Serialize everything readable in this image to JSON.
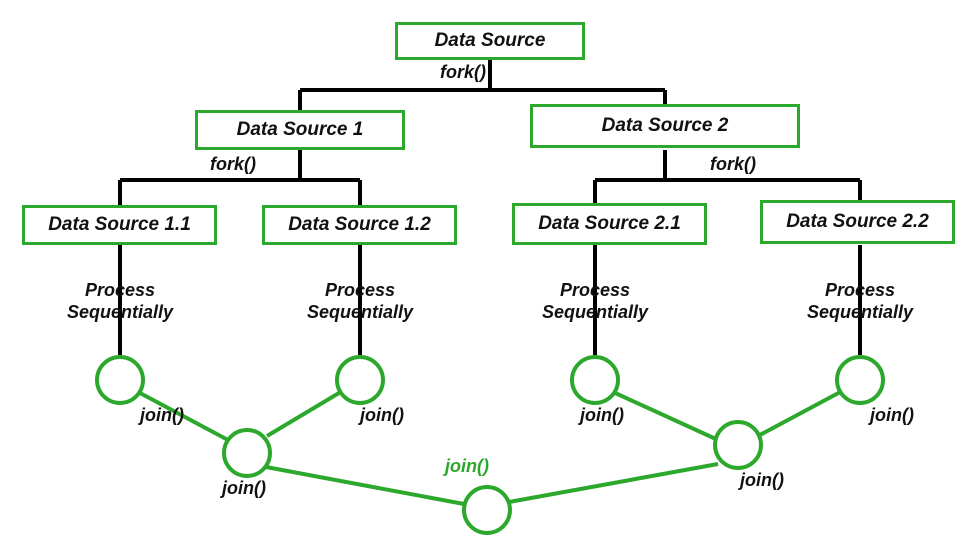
{
  "diagram": {
    "root": {
      "label": "Data Source"
    },
    "fork_root": "fork()",
    "level1_left": {
      "label": "Data Source 1"
    },
    "level1_right": {
      "label": "Data Source 2"
    },
    "fork_left": "fork()",
    "fork_right": "fork()",
    "leaf_11": {
      "label": "Data Source 1.1"
    },
    "leaf_12": {
      "label": "Data Source 1.2"
    },
    "leaf_21": {
      "label": "Data Source 2.1"
    },
    "leaf_22": {
      "label": "Data Source 2.2"
    },
    "process_11": "Process Sequentially",
    "process_12": "Process Sequentially",
    "process_21": "Process Sequentially",
    "process_22": "Process Sequentially",
    "join_11": "join()",
    "join_12": "join()",
    "join_21": "join()",
    "join_22": "join()",
    "join_mid_left": "join()",
    "join_mid_right": "join()",
    "join_center": "join()",
    "colors": {
      "box_border": "#2ca82c",
      "circle_border": "#2ca82c",
      "line_black": "#000000",
      "line_green": "#2ca82c"
    }
  }
}
